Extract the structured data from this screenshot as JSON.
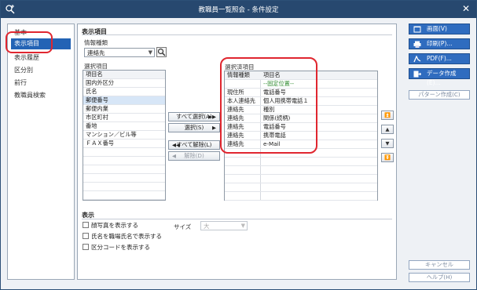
{
  "window": {
    "title": "教職員一覧照会 - 条件設定"
  },
  "nav": {
    "items": [
      {
        "label": "基本"
      },
      {
        "label": "表示項目"
      },
      {
        "label": "表示履歴"
      },
      {
        "label": "区分別"
      },
      {
        "label": "前行"
      },
      {
        "label": "教職員検索"
      }
    ],
    "active_index": 1
  },
  "display_items": {
    "section_label": "表示項目",
    "info_type_label": "情報種類",
    "info_type_value": "連絡先",
    "selection_label": "選択項目",
    "selection_header": "項目名",
    "selection_items": [
      "国内外区分",
      "氏名",
      "郵便番号",
      "郵便内業",
      "市区町村",
      "番地",
      "マンション／ビル等",
      "ＦＡＸ番号"
    ],
    "selected_label": "選択済項目",
    "selected_headers": [
      "情報種類",
      "項目名"
    ],
    "selected_rows": [
      {
        "type": "",
        "name": "--固定位置--"
      },
      {
        "type": "現住所",
        "name": "電話番号"
      },
      {
        "type": "本人連絡先",
        "name": "個人用携帯電話１"
      },
      {
        "type": "連絡先",
        "name": "種別"
      },
      {
        "type": "連絡先",
        "name": "関係(続柄)"
      },
      {
        "type": "連絡先",
        "name": "電話番号"
      },
      {
        "type": "連絡先",
        "name": "携帯電話"
      },
      {
        "type": "連絡先",
        "name": "e-Mail"
      }
    ],
    "buttons": {
      "select_all": "すべて選択(A)",
      "select": "選択(S)",
      "deselect_all": "すべて解除(L)",
      "deselect": "解除(D)"
    },
    "order_buttons": [
      "⏫",
      "▲",
      "▼",
      "⏬"
    ]
  },
  "display": {
    "section_label": "表示",
    "options": [
      {
        "label": "顔写真を表示する",
        "checked": false
      },
      {
        "label": "氏名を職場氏名で表示する",
        "checked": false
      },
      {
        "label": "区分コードを表示する",
        "checked": false
      }
    ],
    "size_label": "サイズ",
    "size_value": "大"
  },
  "right_panel": {
    "screen_button": "画面(V)",
    "print_button": "印刷(P)...",
    "pdf_button": "PDF(F)...",
    "data_button": "データ作成(E)...",
    "pattern_button": "パターン作成(C)",
    "cancel_button": "キャンセル",
    "help_button": "ヘルプ(H)"
  },
  "colors": {
    "titlebar": "#27486f",
    "accent": "#2f6cbf",
    "highlight": "#e0262f",
    "fixed_position_text": "#2e8b2e"
  }
}
